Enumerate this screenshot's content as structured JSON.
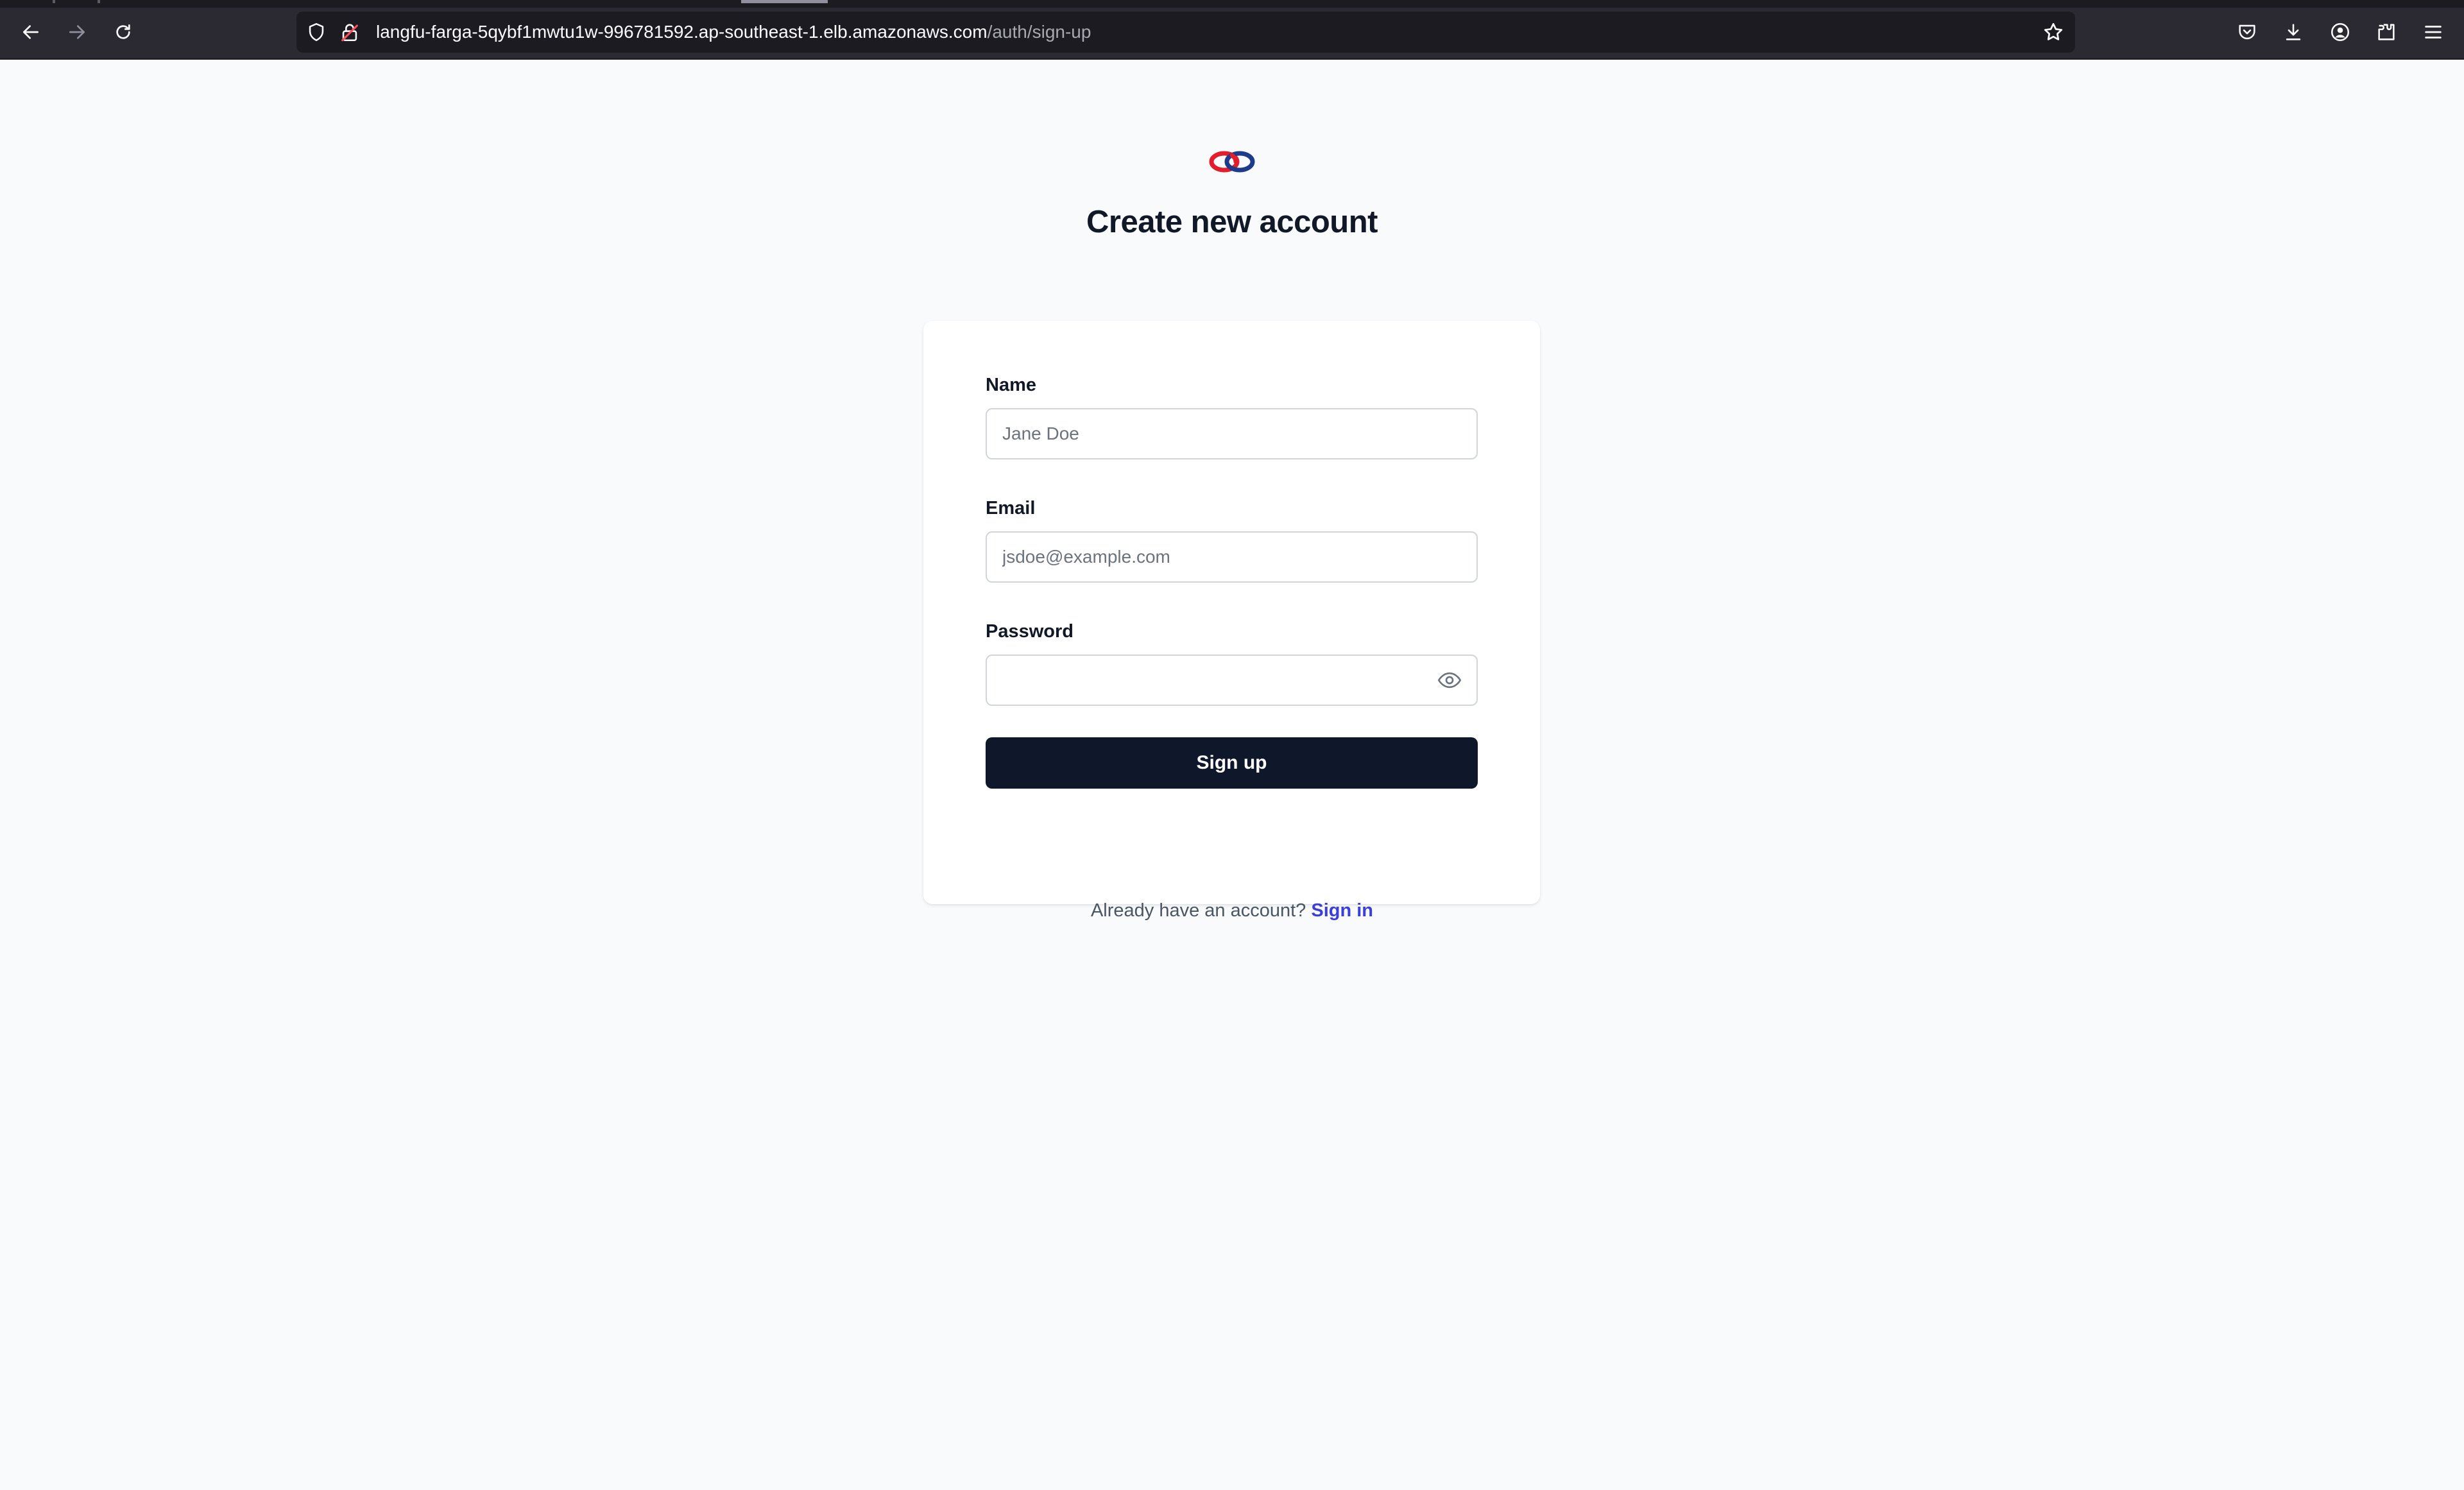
{
  "browser": {
    "url_host": "langfu-farga-5qybf1mwtu1w-996781592.ap-southeast-1.elb.amazonaws.com",
    "url_path": "/auth/sign-up",
    "icons": {
      "back": "arrow-left-icon",
      "forward": "arrow-right-icon",
      "reload": "reload-icon",
      "shield": "shield-icon",
      "lock": "lock-icon",
      "bookmark": "star-icon",
      "pocket": "pocket-icon",
      "downloads": "download-icon",
      "account": "account-icon",
      "extensions": "extensions-icon",
      "menu": "hamburger-menu-icon"
    }
  },
  "page": {
    "title": "Create new account",
    "logo": "langfuse-logo",
    "form": {
      "name_label": "Name",
      "name_placeholder": "Jane Doe",
      "email_label": "Email",
      "email_placeholder": "jsdoe@example.com",
      "password_label": "Password",
      "password_placeholder": "",
      "password_toggle_icon": "eye-icon",
      "submit_label": "Sign up"
    },
    "footer": {
      "prompt": "Already have an account?",
      "link_label": "Sign in"
    }
  },
  "colors": {
    "primary_button": "#0f172a",
    "link": "#3b3fd8",
    "background": "#f8fafc",
    "chrome": "#2b2a33"
  }
}
